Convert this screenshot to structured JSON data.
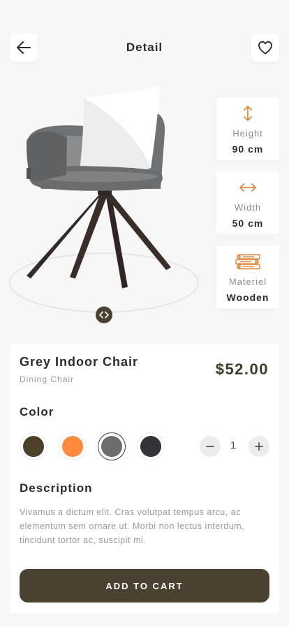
{
  "header": {
    "title": "Detail"
  },
  "specs": [
    {
      "label": "Height",
      "value": "90 cm",
      "icon": "vertical-arrow-icon"
    },
    {
      "label": "Width",
      "value": "50 cm",
      "icon": "horizontal-arrow-icon"
    },
    {
      "label": "Materiel",
      "value": "Wooden",
      "icon": "wood-planks-icon"
    }
  ],
  "product": {
    "name": "Grey Indoor Chair",
    "category": "Dining Chair",
    "price": "$52.00"
  },
  "color_section": {
    "title": "Color",
    "options": [
      "#4a4128",
      "#ff8a3d",
      "#6b6d6f",
      "#333338"
    ],
    "selected_index": 2
  },
  "quantity": "1",
  "description": {
    "title": "Description",
    "text": "Vivamus a dictum elit. Cras volutpat tempus arcu, ac elementum sem ornare ut. Morbi non lectus interdum, tincidunt tortor ac, suscipit mi."
  },
  "cart_button": "ADD TO CART",
  "accent_color": "#e08a3c",
  "primary_color": "#4a4131"
}
